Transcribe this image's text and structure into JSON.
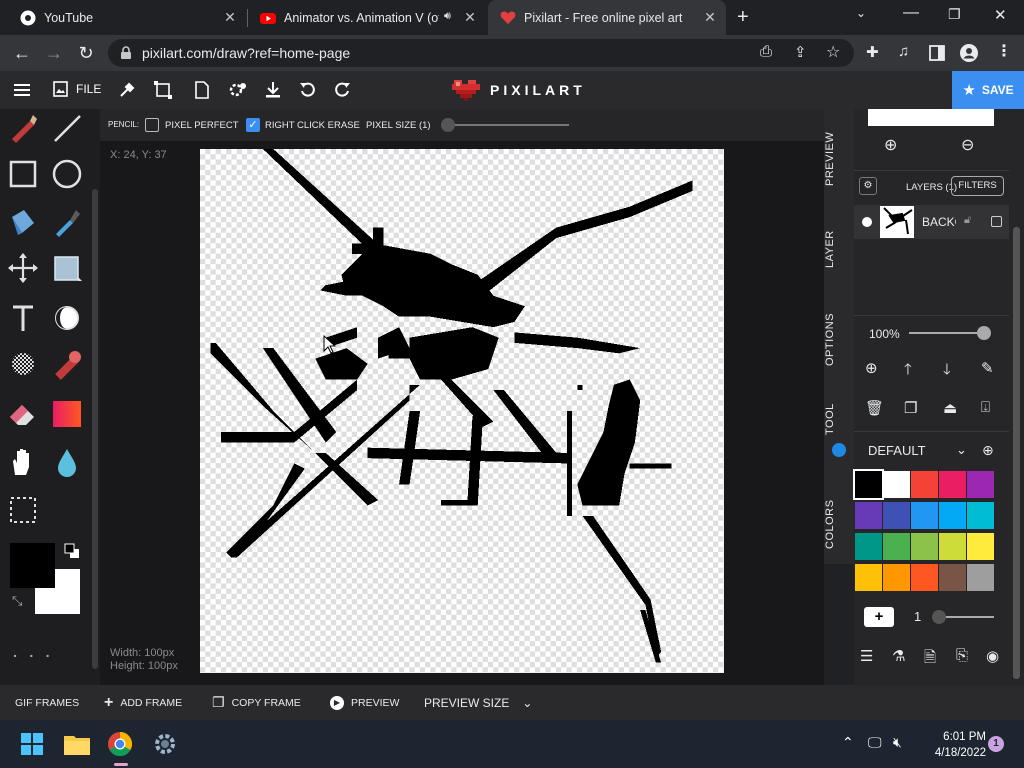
{
  "browser": {
    "tabs": [
      {
        "title": "YouTube",
        "active": false
      },
      {
        "title": "Animator vs. Animation V (of",
        "active": false
      },
      {
        "title": "Pixilart - Free online pixel art dra",
        "active": true
      }
    ],
    "new_tab": "+",
    "url": "pixilart.com/draw?ref=home-page"
  },
  "app": {
    "file_label": "FILE",
    "logo_text": "PIXILART",
    "save_label": "SAVE",
    "accent": "#3b8ff0"
  },
  "options": {
    "tool_name": "PENCIL:",
    "pixel_perfect": {
      "label": "PIXEL PERFECT",
      "checked": false
    },
    "right_click_erase": {
      "label": "RIGHT CLICK ERASE",
      "checked": true
    },
    "pixel_size": {
      "label": "PIXEL SIZE (1)",
      "value": 1
    }
  },
  "canvas": {
    "cursor_coords": "X: 24, Y: 37",
    "width_label": "Width: 100px",
    "height_label": "Height: 100px"
  },
  "right_tabs": {
    "preview": "PREVIEW",
    "layer": "LAYER",
    "options": "OPTIONS",
    "tool": "TOOL",
    "colors": "COLORS"
  },
  "layers": {
    "header": "LAYERS (1)",
    "filters": "FILTERS",
    "items": [
      {
        "name": "BACKG"
      }
    ],
    "opacity_label": "100%",
    "opacity": 1.0
  },
  "palette": {
    "name": "DEFAULT",
    "colors": [
      "#000000",
      "#ffffff",
      "#f44336",
      "#e91e63",
      "#9c27b0",
      "#673ab7",
      "#3f51b5",
      "#2196f3",
      "#03a9f4",
      "#00bcd4",
      "#009688",
      "#4caf50",
      "#8bc34a",
      "#cddc39",
      "#ffeb3b",
      "#ffc107",
      "#ff9800",
      "#ff5722",
      "#795548",
      "#9e9e9e"
    ],
    "brush_size": "1"
  },
  "frames": {
    "gif_frames": "GIF FRAMES",
    "add_frame": "ADD FRAME",
    "copy_frame": "COPY FRAME",
    "preview": "PREVIEW",
    "preview_size": "PREVIEW SIZE"
  },
  "taskbar": {
    "time": "6:01 PM",
    "date": "4/18/2022",
    "notifications": "1"
  }
}
